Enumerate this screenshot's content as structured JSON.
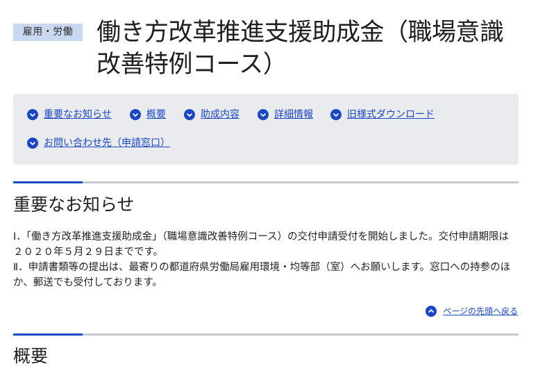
{
  "category_tag": "雇用・労働",
  "page_title": "働き方改革推進支援助成金（職場意識改善特例コース）",
  "nav": {
    "items": [
      {
        "label": "重要なお知らせ",
        "icon": "chevron-down-circle-icon"
      },
      {
        "label": "概要",
        "icon": "chevron-down-circle-icon"
      },
      {
        "label": "助成内容",
        "icon": "chevron-down-circle-icon"
      },
      {
        "label": "詳細情報",
        "icon": "chevron-down-circle-icon"
      },
      {
        "label": "旧様式ダウンロード",
        "icon": "chevron-down-circle-icon"
      },
      {
        "label": "お問い合わせ先（申請窓口）",
        "icon": "chevron-down-circle-icon"
      }
    ]
  },
  "sections": {
    "important": {
      "heading": "重要なお知らせ",
      "paragraphs": [
        "Ⅰ．「働き方改革推進支援助成金」（職場意識改善特例コース）の交付申請受付を開始しました。交付申請期限は２０２０年５月２９日までです。",
        "Ⅱ．申請書類等の提出は、最寄りの都道府県労働局雇用環境・均等部（室）へお願いします。窓口への持参のほか、郵送でも受付しております。"
      ],
      "back_to_top": "ページの先頭へ戻る"
    },
    "overview": {
      "heading": "概要"
    }
  },
  "colors": {
    "link": "#1a47c4",
    "tag_bg": "#c9d8f0",
    "nav_bg": "#e9ebef",
    "rule": "#c8c9cd",
    "accent": "#1a47c4"
  }
}
